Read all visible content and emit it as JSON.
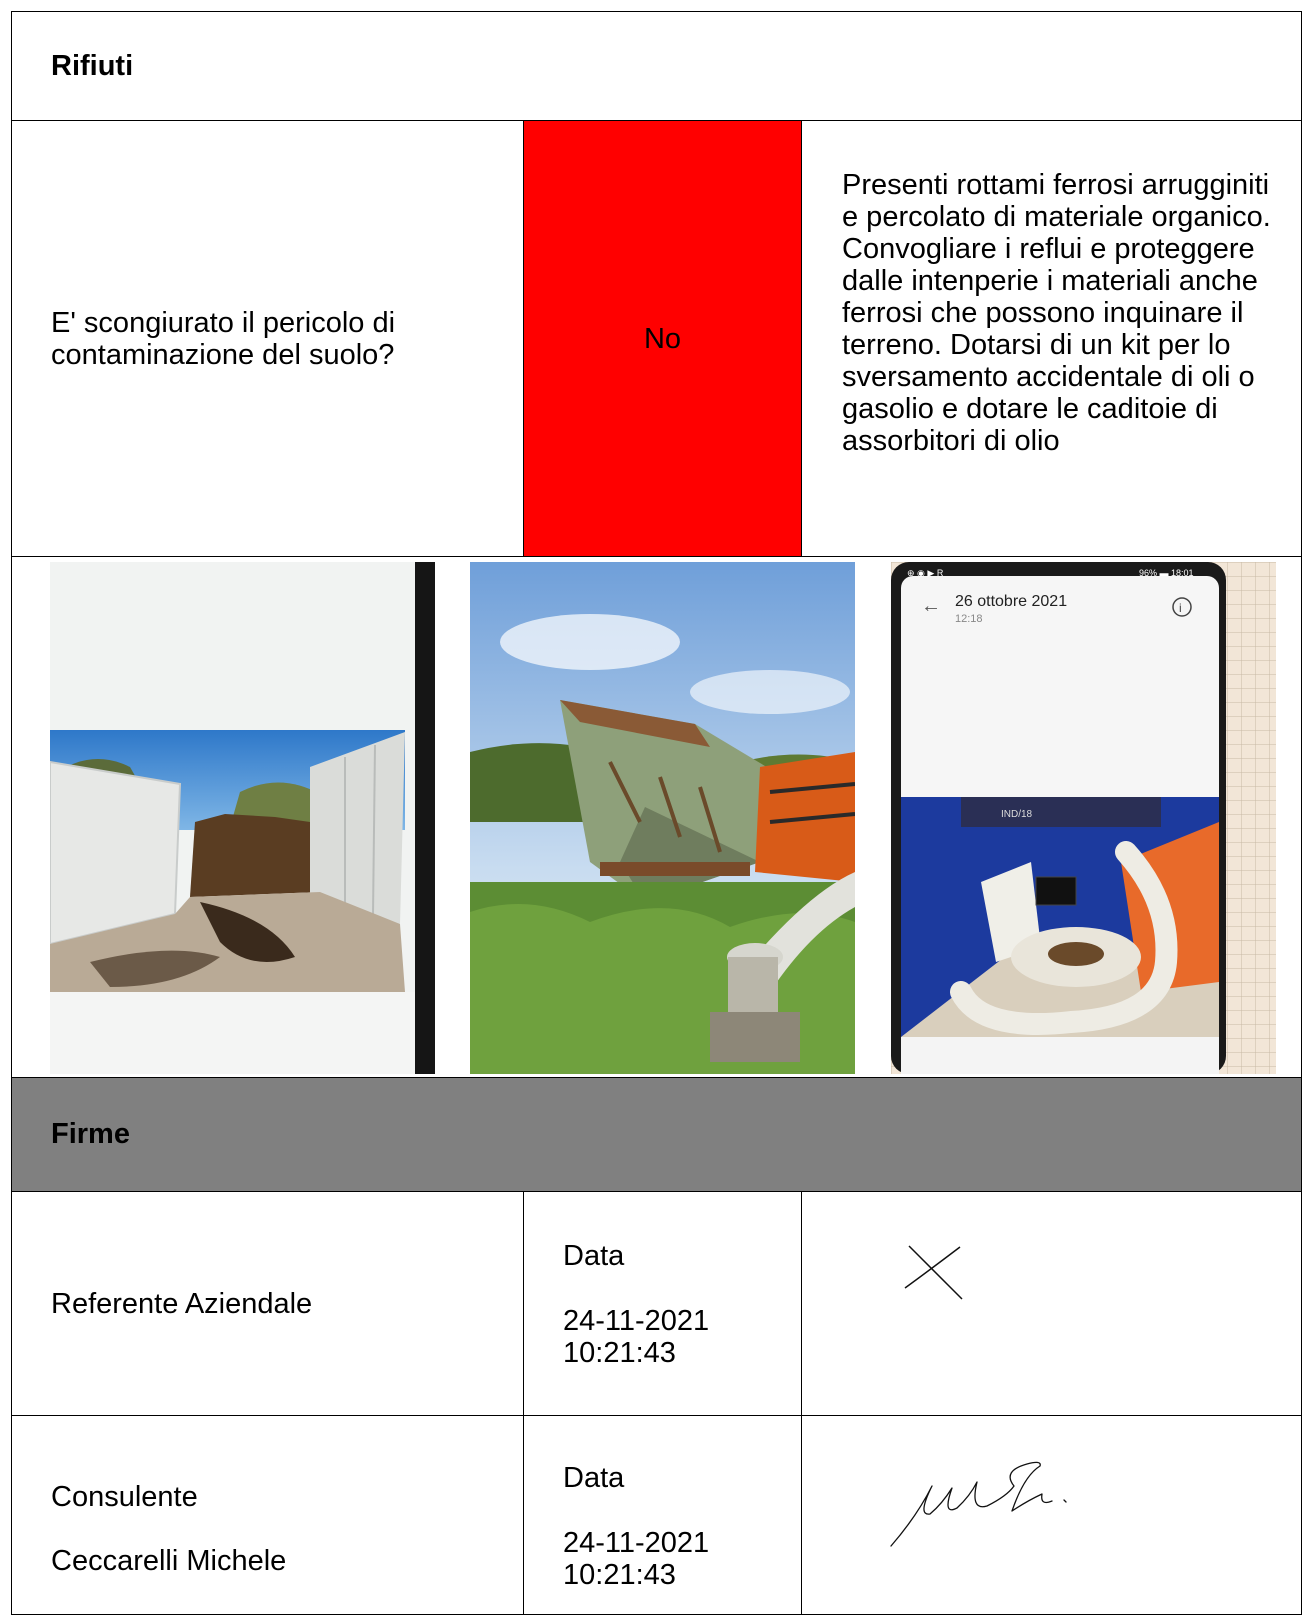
{
  "section_rifiuti": {
    "title": "Rifiuti",
    "question": "E' scongiurato il pericolo di contaminazione del suolo?",
    "answer": "No",
    "answer_color": "#ff0000",
    "note": "Presenti rottami ferrosi arrugginiti e percolato di materiale organico. Convogliare i reflui e proteggere dalle intenperie i materiali anche ferrosi che possono inquinare il terreno. Dotarsi di un kit per lo sversamento accidentale di oli o gasolio e dotare le caditoie di assorbitori di olio"
  },
  "photos": {
    "phone_status_left": "96% ▬ 18:01",
    "phone_date": "26 ottobre 2021",
    "phone_time": "12:18",
    "kit_label": "IND/18"
  },
  "section_firme": {
    "title": "Firme",
    "header_bg": "#808080",
    "rows": [
      {
        "role": "Referente Aziendale",
        "name": "",
        "date_label": "Data",
        "date_value": "24-11-2021 10:21:43"
      },
      {
        "role": "Consulente",
        "name": "Ceccarelli Michele",
        "date_label": "Data",
        "date_value": "24-11-2021 10:21:43"
      }
    ]
  }
}
